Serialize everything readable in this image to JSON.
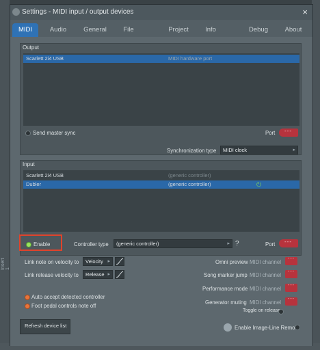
{
  "window": {
    "title": "Settings - MIDI input / output devices",
    "close_glyph": "×"
  },
  "tabs": [
    {
      "label": "MIDI",
      "active": true
    },
    {
      "label": "Audio",
      "active": false
    },
    {
      "label": "General",
      "active": false
    },
    {
      "label": "File",
      "active": false
    },
    {
      "label": "Project",
      "active": false
    },
    {
      "label": "Info",
      "active": false
    },
    {
      "label": "Debug",
      "active": false
    },
    {
      "label": "About",
      "active": false
    }
  ],
  "output": {
    "label": "Output",
    "devices": [
      {
        "name": "Scarlett 2i4 USB",
        "type": "MIDI hardware port",
        "selected": true
      }
    ],
    "send_master_sync": "Send master sync",
    "port_label": "Port",
    "port_value": "---",
    "sync_type_label": "Synchronization type",
    "sync_type_value": "MIDI clock"
  },
  "input": {
    "label": "Input",
    "devices": [
      {
        "name": "Scarlett 2i4 USB",
        "type": "(generic controller)",
        "selected": false
      },
      {
        "name": "Dubler",
        "type": "(generic controller)",
        "selected": true
      }
    ],
    "enable_label": "Enable",
    "controller_type_label": "Controller type",
    "controller_type_value": "(generic controller)",
    "help_glyph": "?",
    "port_label": "Port",
    "port_value": "---"
  },
  "options": {
    "link_note_label": "Link note on velocity to",
    "link_note_value": "Velocity",
    "link_release_label": "Link release velocity to",
    "link_release_value": "Release",
    "auto_accept": "Auto accept detected controller",
    "foot_pedal": "Foot pedal controls note off",
    "omni_preview": "Omni preview",
    "song_marker_jump": "Song marker jump",
    "performance_mode": "Performance mode",
    "generator_muting": "Generator muting",
    "midi_channel": "MIDI channel",
    "channel_value": "---",
    "toggle_on_release": "Toggle on release"
  },
  "footer": {
    "refresh_button": "Refresh device list",
    "enable_remote": "Enable Image-Line Remote"
  },
  "side": {
    "insert_label": "Insert 1"
  },
  "colors": {
    "accent_blue": "#2f72b5",
    "port_red": "#b7333d",
    "led_green": "#7fd35b",
    "led_orange": "#e8743b",
    "highlight": "#e0432b"
  }
}
